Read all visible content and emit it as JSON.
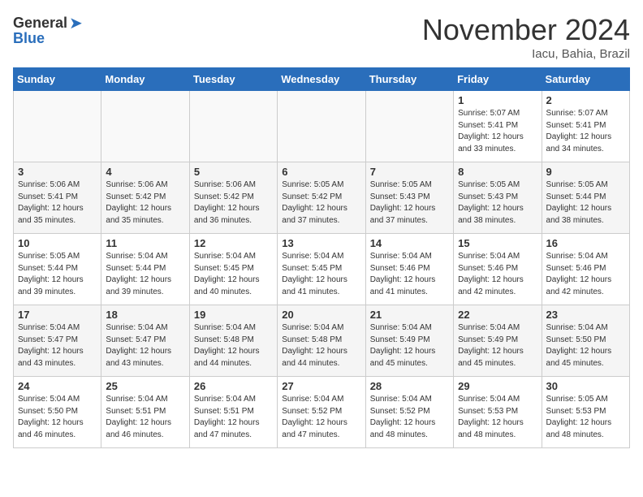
{
  "logo": {
    "general": "General",
    "blue": "Blue"
  },
  "title": "November 2024",
  "location": "Iacu, Bahia, Brazil",
  "days_of_week": [
    "Sunday",
    "Monday",
    "Tuesday",
    "Wednesday",
    "Thursday",
    "Friday",
    "Saturday"
  ],
  "weeks": [
    [
      {
        "day": "",
        "info": ""
      },
      {
        "day": "",
        "info": ""
      },
      {
        "day": "",
        "info": ""
      },
      {
        "day": "",
        "info": ""
      },
      {
        "day": "",
        "info": ""
      },
      {
        "day": "1",
        "info": "Sunrise: 5:07 AM\nSunset: 5:41 PM\nDaylight: 12 hours\nand 33 minutes."
      },
      {
        "day": "2",
        "info": "Sunrise: 5:07 AM\nSunset: 5:41 PM\nDaylight: 12 hours\nand 34 minutes."
      }
    ],
    [
      {
        "day": "3",
        "info": "Sunrise: 5:06 AM\nSunset: 5:41 PM\nDaylight: 12 hours\nand 35 minutes."
      },
      {
        "day": "4",
        "info": "Sunrise: 5:06 AM\nSunset: 5:42 PM\nDaylight: 12 hours\nand 35 minutes."
      },
      {
        "day": "5",
        "info": "Sunrise: 5:06 AM\nSunset: 5:42 PM\nDaylight: 12 hours\nand 36 minutes."
      },
      {
        "day": "6",
        "info": "Sunrise: 5:05 AM\nSunset: 5:42 PM\nDaylight: 12 hours\nand 37 minutes."
      },
      {
        "day": "7",
        "info": "Sunrise: 5:05 AM\nSunset: 5:43 PM\nDaylight: 12 hours\nand 37 minutes."
      },
      {
        "day": "8",
        "info": "Sunrise: 5:05 AM\nSunset: 5:43 PM\nDaylight: 12 hours\nand 38 minutes."
      },
      {
        "day": "9",
        "info": "Sunrise: 5:05 AM\nSunset: 5:44 PM\nDaylight: 12 hours\nand 38 minutes."
      }
    ],
    [
      {
        "day": "10",
        "info": "Sunrise: 5:05 AM\nSunset: 5:44 PM\nDaylight: 12 hours\nand 39 minutes."
      },
      {
        "day": "11",
        "info": "Sunrise: 5:04 AM\nSunset: 5:44 PM\nDaylight: 12 hours\nand 39 minutes."
      },
      {
        "day": "12",
        "info": "Sunrise: 5:04 AM\nSunset: 5:45 PM\nDaylight: 12 hours\nand 40 minutes."
      },
      {
        "day": "13",
        "info": "Sunrise: 5:04 AM\nSunset: 5:45 PM\nDaylight: 12 hours\nand 41 minutes."
      },
      {
        "day": "14",
        "info": "Sunrise: 5:04 AM\nSunset: 5:46 PM\nDaylight: 12 hours\nand 41 minutes."
      },
      {
        "day": "15",
        "info": "Sunrise: 5:04 AM\nSunset: 5:46 PM\nDaylight: 12 hours\nand 42 minutes."
      },
      {
        "day": "16",
        "info": "Sunrise: 5:04 AM\nSunset: 5:46 PM\nDaylight: 12 hours\nand 42 minutes."
      }
    ],
    [
      {
        "day": "17",
        "info": "Sunrise: 5:04 AM\nSunset: 5:47 PM\nDaylight: 12 hours\nand 43 minutes."
      },
      {
        "day": "18",
        "info": "Sunrise: 5:04 AM\nSunset: 5:47 PM\nDaylight: 12 hours\nand 43 minutes."
      },
      {
        "day": "19",
        "info": "Sunrise: 5:04 AM\nSunset: 5:48 PM\nDaylight: 12 hours\nand 44 minutes."
      },
      {
        "day": "20",
        "info": "Sunrise: 5:04 AM\nSunset: 5:48 PM\nDaylight: 12 hours\nand 44 minutes."
      },
      {
        "day": "21",
        "info": "Sunrise: 5:04 AM\nSunset: 5:49 PM\nDaylight: 12 hours\nand 45 minutes."
      },
      {
        "day": "22",
        "info": "Sunrise: 5:04 AM\nSunset: 5:49 PM\nDaylight: 12 hours\nand 45 minutes."
      },
      {
        "day": "23",
        "info": "Sunrise: 5:04 AM\nSunset: 5:50 PM\nDaylight: 12 hours\nand 45 minutes."
      }
    ],
    [
      {
        "day": "24",
        "info": "Sunrise: 5:04 AM\nSunset: 5:50 PM\nDaylight: 12 hours\nand 46 minutes."
      },
      {
        "day": "25",
        "info": "Sunrise: 5:04 AM\nSunset: 5:51 PM\nDaylight: 12 hours\nand 46 minutes."
      },
      {
        "day": "26",
        "info": "Sunrise: 5:04 AM\nSunset: 5:51 PM\nDaylight: 12 hours\nand 47 minutes."
      },
      {
        "day": "27",
        "info": "Sunrise: 5:04 AM\nSunset: 5:52 PM\nDaylight: 12 hours\nand 47 minutes."
      },
      {
        "day": "28",
        "info": "Sunrise: 5:04 AM\nSunset: 5:52 PM\nDaylight: 12 hours\nand 48 minutes."
      },
      {
        "day": "29",
        "info": "Sunrise: 5:04 AM\nSunset: 5:53 PM\nDaylight: 12 hours\nand 48 minutes."
      },
      {
        "day": "30",
        "info": "Sunrise: 5:05 AM\nSunset: 5:53 PM\nDaylight: 12 hours\nand 48 minutes."
      }
    ]
  ]
}
